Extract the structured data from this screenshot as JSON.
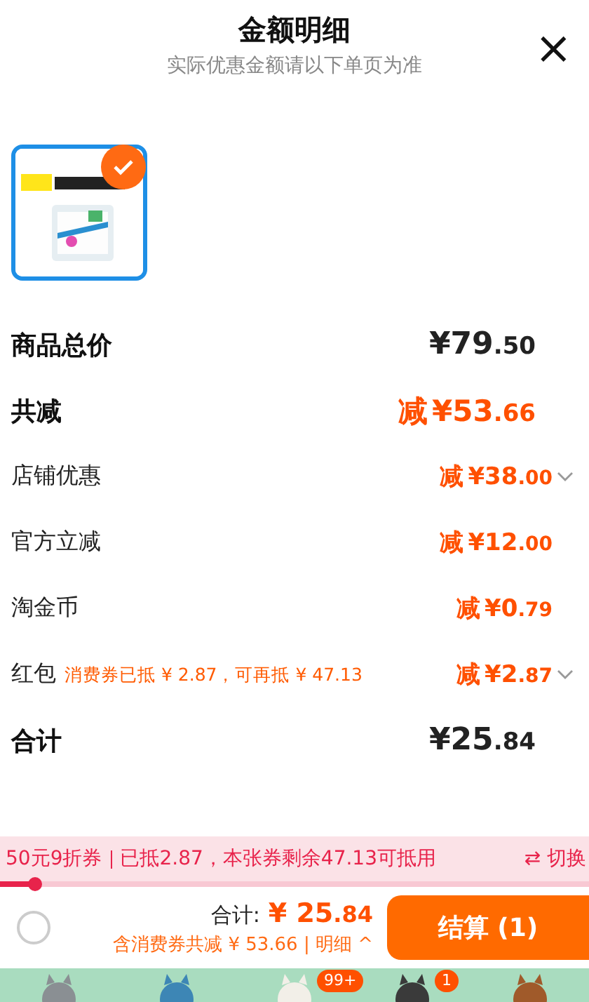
{
  "header": {
    "title": "金额明细",
    "subtitle": "实际优惠金额请以下单页为准",
    "close": "×"
  },
  "product": {
    "kind": "picture",
    "checked": true
  },
  "rows": [
    {
      "kind": "total",
      "label": "商品总价",
      "prefix": "",
      "amount": "¥79",
      "cents": ".50",
      "expandable": false
    },
    {
      "kind": "saving",
      "label": "共减",
      "prefix": "减",
      "amount": "¥53",
      "cents": ".66",
      "expandable": false
    },
    {
      "kind": "item",
      "label": "店铺优惠",
      "prefix": "减",
      "amount": "¥38",
      "cents": ".00",
      "expandable": true
    },
    {
      "kind": "item",
      "label": "官方立减",
      "prefix": "减",
      "amount": "¥12",
      "cents": ".00",
      "expandable": false
    },
    {
      "kind": "item",
      "label": "淘金币",
      "prefix": "减",
      "amount": "¥0",
      "cents": ".79",
      "expandable": false
    },
    {
      "kind": "item",
      "label": "红包",
      "note": "消费券已抵 ¥ 2.87，可再抵 ¥ 47.13",
      "prefix": "减",
      "amount": "¥2",
      "cents": ".87",
      "expandable": true
    },
    {
      "kind": "total",
      "label": "合计",
      "prefix": "",
      "amount": "¥25",
      "cents": ".84",
      "expandable": false
    }
  ],
  "coupon": {
    "name": "50元9折券",
    "info": "已抵2.87，本张券剩余47.13可抵用",
    "switch": "⇄ 切换",
    "level": 0.06
  },
  "checkout": {
    "selected": false,
    "total_label": "合计:",
    "total": "¥ 25",
    "total_cents": ".84",
    "summary": "含消费券共减 ¥ 53.66 | 明细 ^",
    "button": "结算 (1)"
  },
  "tabbar": [
    {
      "kind": "character"
    },
    {
      "kind": "character"
    },
    {
      "kind": "character",
      "badge": "99+"
    },
    {
      "kind": "character",
      "badge": "1"
    },
    {
      "kind": "character"
    }
  ]
}
